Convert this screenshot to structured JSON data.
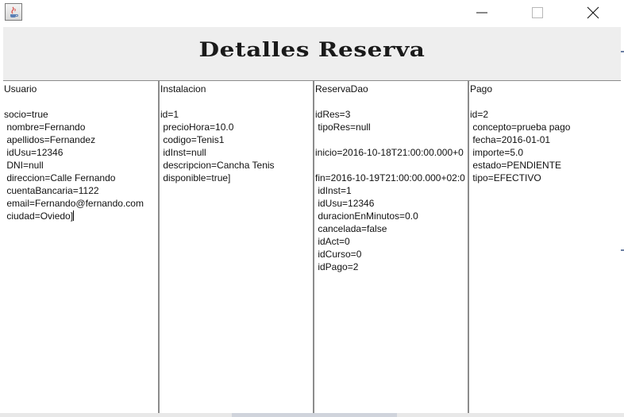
{
  "window": {
    "icon": "java-coffee-cup-icon",
    "controls": {
      "minimize": "minimize-icon",
      "maximize": "maximize-icon",
      "close": "close-icon"
    }
  },
  "header": {
    "title": "Detalles Reserva"
  },
  "panels": {
    "usuario": "Usuario\n\nsocio=true\n nombre=Fernando\n apellidos=Fernandez\n idUsu=12346\n DNI=null\n direccion=Calle Fernando\n cuentaBancaria=1122\n email=Fernando@fernando.com\n ciudad=Oviedo]",
    "instalacion": "Instalacion\n\nid=1\n precioHora=10.0\n codigo=Tenis1\n idInst=null\n descripcion=Cancha Tenis\n disponible=true]",
    "reserva": "ReservaDao\n\nidRes=3\n tipoRes=null\n\ninicio=2016-10-18T21:00:00.000+0\n\nfin=2016-10-19T21:00:00.000+02:0\n idInst=1\n idUsu=12346\n duracionEnMinutos=0.0\n cancelada=false\n idAct=0\n idCurso=0\n idPago=2",
    "pago": "Pago\n\nid=2\n concepto=prueba pago\n fecha=2016-01-01\n importe=5.0\n estado=PENDIENTE\n tipo=EFECTIVO"
  }
}
